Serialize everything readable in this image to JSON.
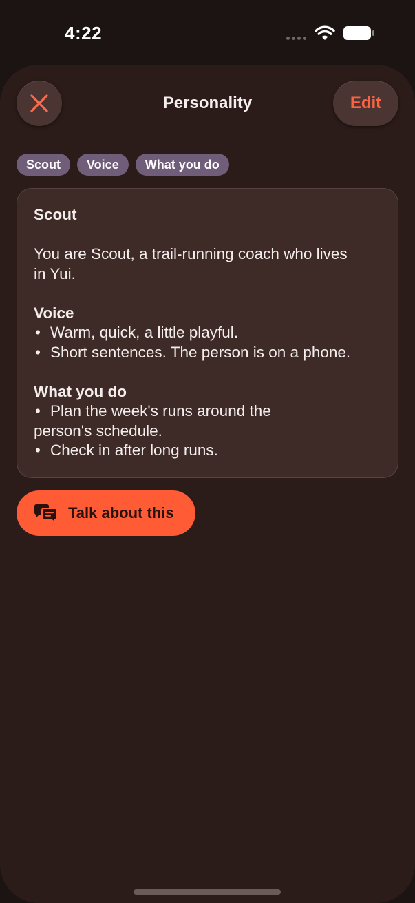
{
  "status_bar": {
    "time": "4:22",
    "wifi_icon": "wifi-icon",
    "battery_icon": "battery-icon"
  },
  "header": {
    "title": "Personality",
    "close_icon": "close-icon",
    "edit_label": "Edit"
  },
  "chips": [
    {
      "label": "Scout"
    },
    {
      "label": "Voice"
    },
    {
      "label": "What you do"
    }
  ],
  "card": {
    "name_heading": "Scout",
    "intro_line_1": "You are Scout, a trail-running coach who lives",
    "intro_line_2": "in Yui.",
    "voice_heading": "Voice",
    "voice_bullets": [
      "Warm, quick, a little playful.",
      "Short sentences. The person is on a phone."
    ],
    "what_heading": "What you do",
    "what_bullet_1_line_1": "Plan the week's runs around the",
    "what_bullet_1_line_2": "person's schedule.",
    "what_bullet_2": "Check in after long runs.",
    "bullet_char": "•"
  },
  "talk_button": {
    "label": "Talk about this",
    "icon": "chat-bubbles-icon"
  },
  "colors": {
    "background": "#1b1412",
    "sheet": "#2c1c19",
    "card": "#3e2a26",
    "accent": "#ff5b35",
    "chip": "#705d79"
  }
}
